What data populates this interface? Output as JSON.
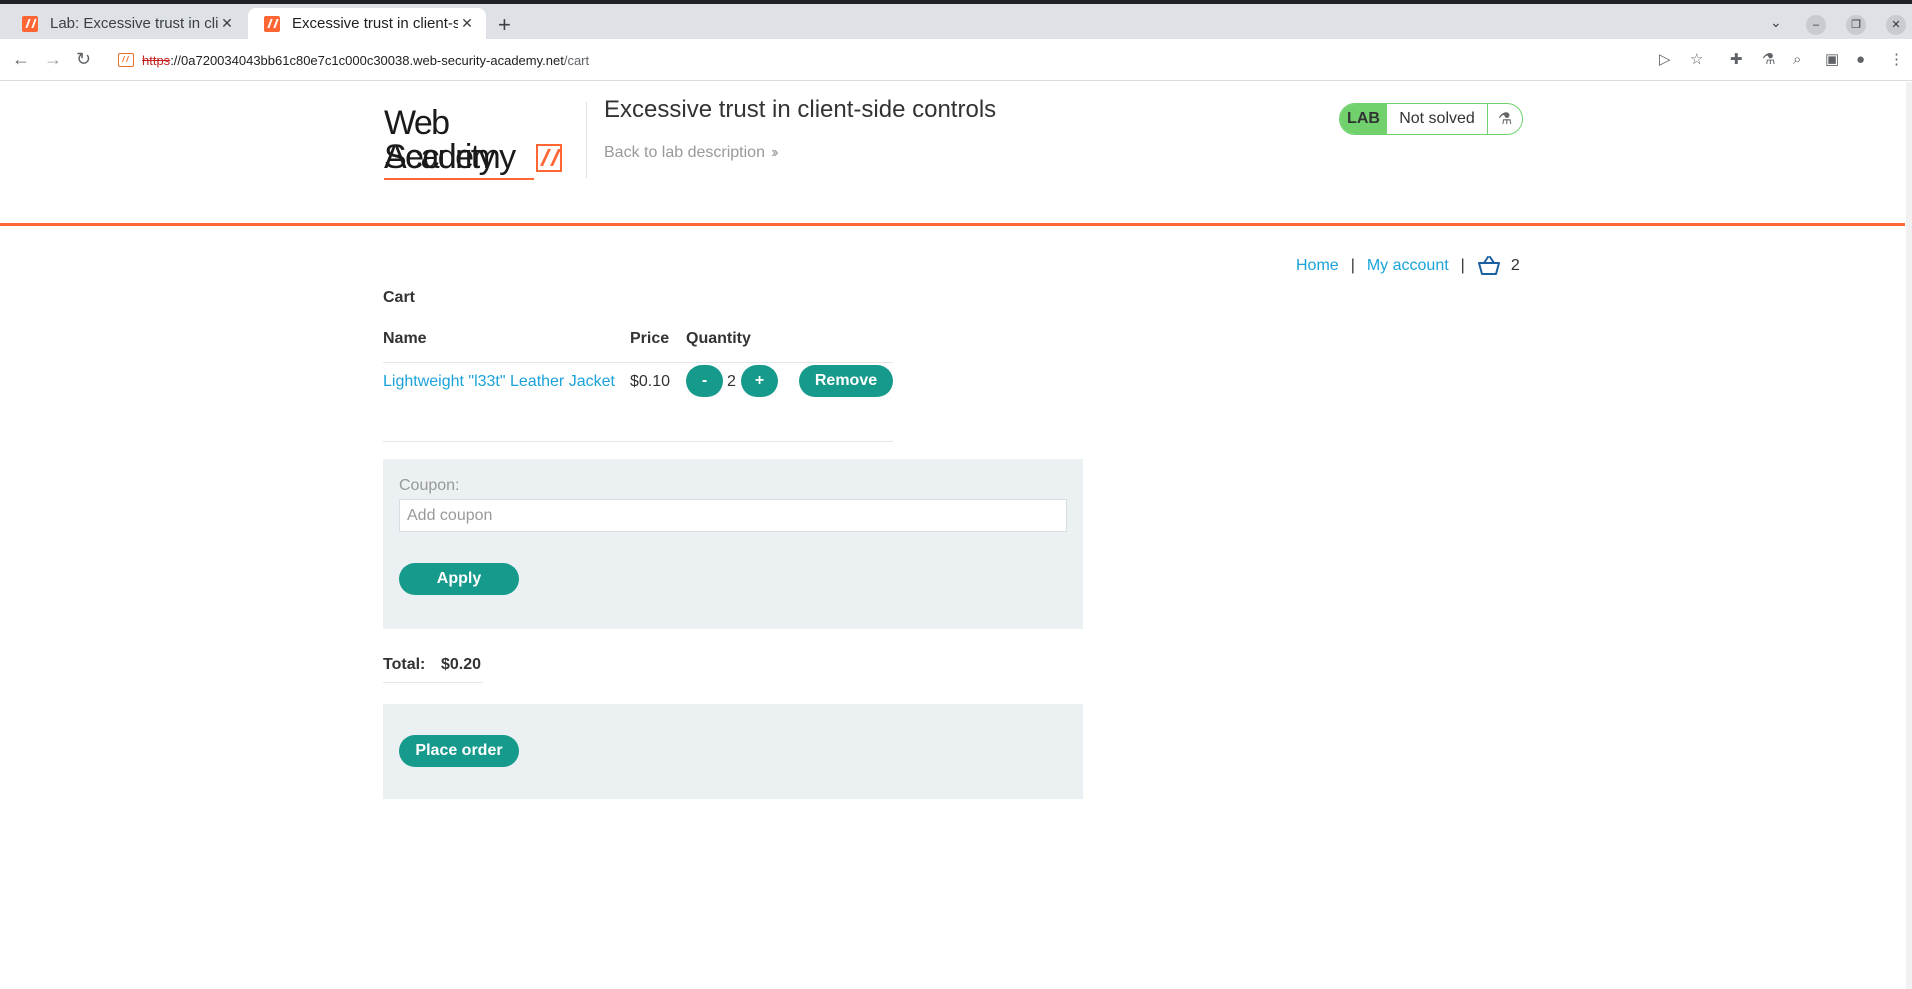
{
  "browser": {
    "tabs": [
      {
        "title": "Lab: Excessive trust in clie",
        "active": false
      },
      {
        "title": "Excessive trust in client-si",
        "active": true
      }
    ],
    "url": {
      "scheme": "https",
      "host": "://0a720034043bb61c80e7c1c000c30038.web-security-academy.net",
      "path": "/cart"
    }
  },
  "header": {
    "logo_line1": "Web Security",
    "logo_line2": "Academy",
    "lab_title": "Excessive trust in client-side controls",
    "back_link": "Back to lab description",
    "badge_lab": "LAB",
    "badge_status": "Not solved"
  },
  "nav": {
    "home": "Home",
    "separator": "|",
    "my_account": "My account",
    "cart_count": "2"
  },
  "cart": {
    "heading": "Cart",
    "columns": {
      "name": "Name",
      "price": "Price",
      "quantity": "Quantity"
    },
    "items": [
      {
        "name": "Lightweight \"l33t\" Leather Jacket",
        "price": "$0.10",
        "quantity": "2"
      }
    ],
    "decrement_label": "-",
    "increment_label": "+",
    "remove_label": "Remove"
  },
  "coupon": {
    "label": "Coupon:",
    "placeholder": "Add coupon",
    "value": "",
    "apply_label": "Apply"
  },
  "total": {
    "label": "Total:",
    "value": "$0.20"
  },
  "order": {
    "place_order_label": "Place order"
  },
  "colors": {
    "accent_orange": "#ff6633",
    "button_teal": "#159a8c",
    "link_blue": "#1aa2d9",
    "badge_green": "#70d16d"
  }
}
